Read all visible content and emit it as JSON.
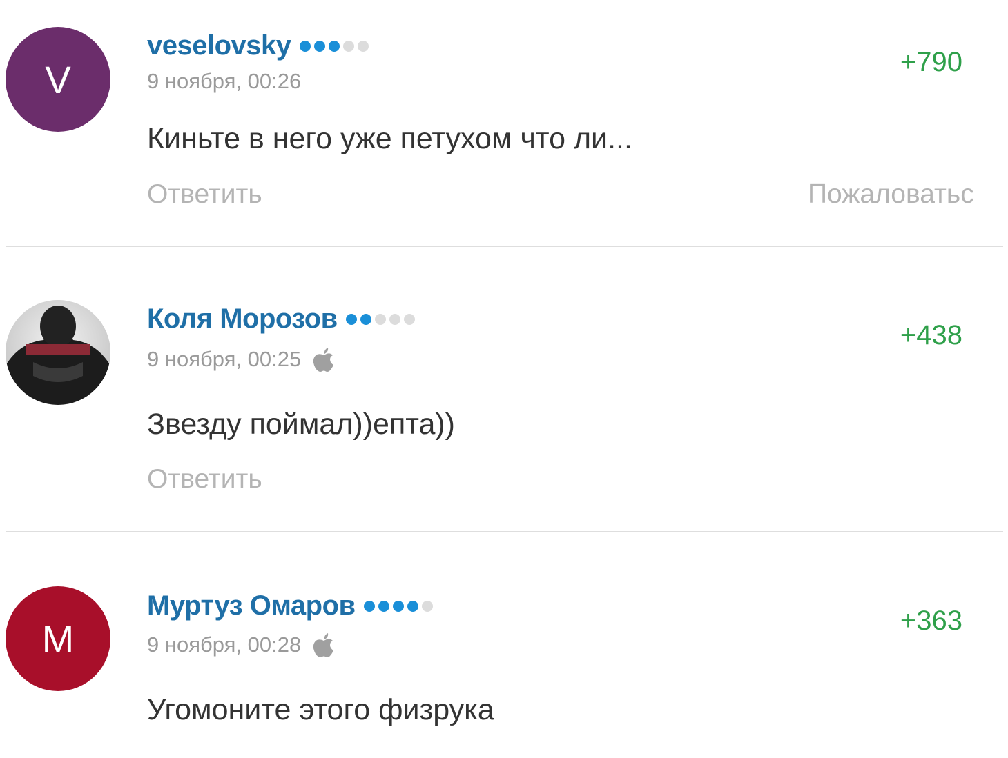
{
  "comments": [
    {
      "avatar_letter": "V",
      "avatar_color": "#6b2d6b",
      "author": "veselovsky",
      "rating_filled": 3,
      "rating_total": 5,
      "time": "9 ноября, 00:26",
      "device_icon": "",
      "score": "+790",
      "text": "Киньте в него уже петухом что ли...",
      "reply_label": "Ответить",
      "report_label": "Пожаловатьс"
    },
    {
      "avatar_letter": "",
      "avatar_color": "#555555",
      "author": "Коля Морозов",
      "rating_filled": 2,
      "rating_total": 5,
      "time": "9 ноября, 00:25",
      "device_icon": "apple-icon",
      "score": "+438",
      "text": "Звезду поймал))епта))",
      "reply_label": "Ответить"
    },
    {
      "avatar_letter": "M",
      "avatar_color": "#a80f2a",
      "author": "Муртуз Омаров",
      "rating_filled": 4,
      "rating_total": 5,
      "time": "9 ноября, 00:28",
      "device_icon": "apple-icon",
      "score": "+363",
      "text": "Угомоните этого физрука"
    }
  ],
  "colors": {
    "author": "#1f6fa7",
    "score_positive": "#2fa04a",
    "rating_on": "#1a8fd8",
    "rating_off": "#dcdcdc",
    "muted": "#9a9a9a"
  }
}
